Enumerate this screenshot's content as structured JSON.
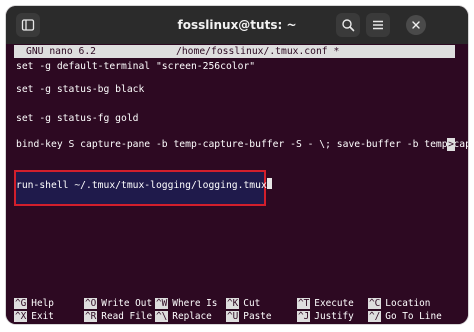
{
  "window": {
    "title": "fosslinux@tuts: ~"
  },
  "titlebar": {
    "new_tab_icon": "new-tab-icon",
    "search_icon": "search-icon",
    "menu_icon": "hamburger-menu-icon",
    "close_icon": "close-icon"
  },
  "nano": {
    "version": "GNU nano 6.2",
    "path": "/home/fosslinux/.tmux.conf *",
    "continue_marker": ">"
  },
  "editor": {
    "lines": [
      "set -g default-terminal \"screen-256color\"",
      "set -g status-bg black",
      "set -g status-fg gold",
      "bind-key S capture-pane -b temp-capture-buffer -S - \\; save-buffer -b temp-capt",
      "run-shell ~/.tmux/tmux-logging/logging.tmux"
    ]
  },
  "shortcuts": [
    {
      "key": "^G",
      "label": "Help"
    },
    {
      "key": "^O",
      "label": "Write Out"
    },
    {
      "key": "^W",
      "label": "Where Is"
    },
    {
      "key": "^K",
      "label": "Cut"
    },
    {
      "key": "^T",
      "label": "Execute"
    },
    {
      "key": "^C",
      "label": "Location"
    },
    {
      "key": "^X",
      "label": "Exit"
    },
    {
      "key": "^R",
      "label": "Read File"
    },
    {
      "key": "^\\",
      "label": "Replace"
    },
    {
      "key": "^U",
      "label": "Paste"
    },
    {
      "key": "^J",
      "label": "Justify"
    },
    {
      "key": "^/",
      "label": "Go To Line"
    }
  ],
  "colors": {
    "terminal_bg": "#2d0922",
    "titlebar_bg": "#2b2b2b",
    "highlight_box": "#d21f2c",
    "close_button_bg": "#4a4a4a"
  }
}
